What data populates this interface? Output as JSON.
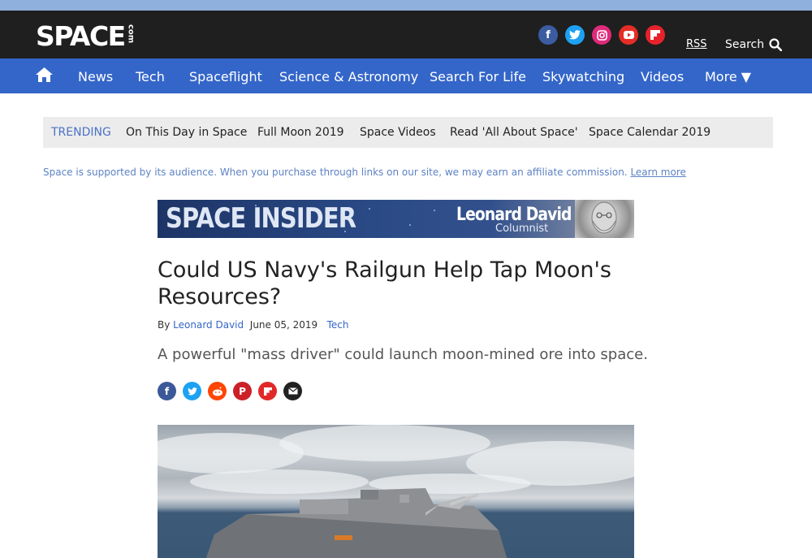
{
  "header": {
    "logo_main": "SPACE",
    "logo_com": "com",
    "social_icons": [
      "facebook-icon",
      "twitter-icon",
      "instagram-icon",
      "youtube-icon",
      "flipboard-icon"
    ],
    "rss_label": "RSS",
    "search_label": "Search"
  },
  "nav": {
    "items": [
      "News",
      "Tech",
      "Spaceflight",
      "Science & Astronomy",
      "Search For Life",
      "Skywatching",
      "Videos",
      "More ▼"
    ]
  },
  "trending": {
    "label": "TRENDING",
    "items": [
      "On This Day in Space",
      "Full Moon 2019",
      "Space Videos",
      "Read 'All About Space'",
      "Space Calendar 2019"
    ]
  },
  "affiliate": {
    "text": "Space is supported by its audience. When you purchase through links on our site, we may earn an affiliate commission.",
    "link": "Learn more"
  },
  "banner": {
    "title": "SPACE INSIDER",
    "name": "Leonard David",
    "role": "Columnist"
  },
  "article": {
    "headline": "Could US Navy's Railgun Help Tap Moon's Resources?",
    "by_prefix": "By",
    "author": "Leonard David",
    "date": "June 05, 2019",
    "category": "Tech",
    "subhead": "A powerful \"mass driver\" could launch moon-mined ore into space."
  },
  "share_icons": [
    "facebook-icon",
    "twitter-icon",
    "reddit-icon",
    "pinterest-icon",
    "flipboard-icon",
    "email-icon"
  ],
  "colors": {
    "header_bg": "#1f1f1f",
    "nav_bg": "#3466c9",
    "top_strip": "#8fb0dd",
    "trending_bg": "#ececec",
    "link": "#3466c9"
  }
}
